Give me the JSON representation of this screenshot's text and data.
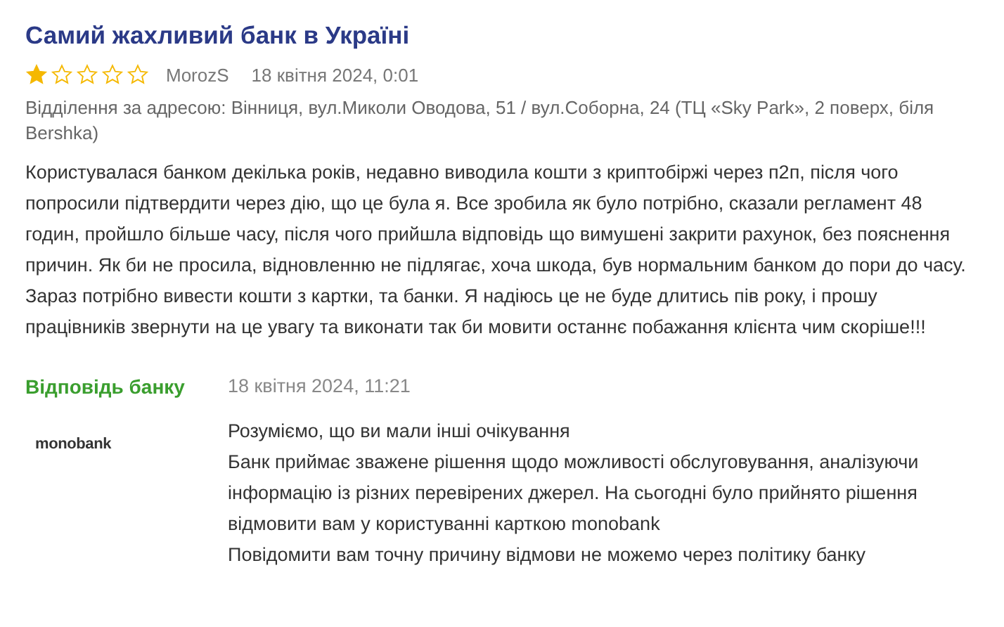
{
  "review": {
    "title": "Самий жахливий банк в Україні",
    "stars": 1,
    "author": "MorozS",
    "date": "18 квітня 2024, 0:01",
    "address": "Відділення за адресою: Вінниця, вул.Миколи Оводова, 51 / вул.Соборна, 24 (ТЦ «Sky Park», 2 поверх, біля Bershka)",
    "text": "Користувалася банком декілька років, недавно виводила кошти з криптобіржі через п2п, після чого попросили підтвердити через дію, що це була я. Все зробила як було потрібно, сказали регламент 48 годин, пройшло більше часу, після чого прийшла відповідь що вимушені закрити рахунок, без пояснення причин. Як би не просила, відновленню не підлягає, хоча шкода, був нормальним банком до пори до часу. Зараз потрібно вивести кошти з картки, та банки. Я надіюсь це не буде длитись пів року, і прошу працівників звернути на це увагу та виконати так би мовити останнє побажання клієнта чим скоріше!!!"
  },
  "reply": {
    "label": "Відповідь банку",
    "date": "18 квітня 2024, 11:21",
    "logo": "monobank",
    "paragraphs": [
      "Розуміємо, що ви мали інші очікування",
      "Банк приймає зважене рішення щодо можливості обслуговування, аналізуючи інформацію із різних перевірених джерел. На сьогодні було прийнято рішення відмовити вам у користуванні карткою monobank",
      "Повідомити вам точну причину відмови не можемо через політику банку"
    ]
  }
}
